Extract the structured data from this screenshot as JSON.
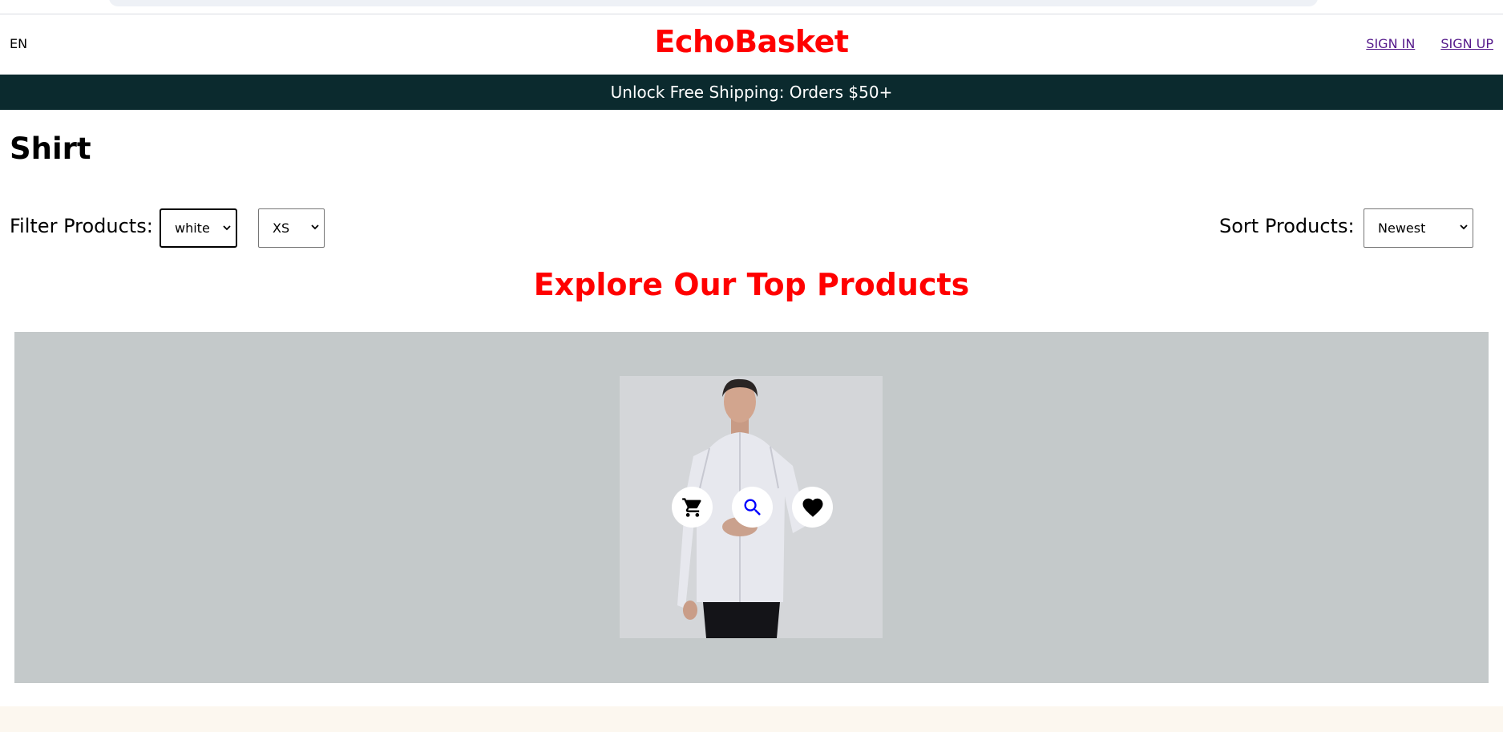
{
  "header": {
    "language": "EN",
    "logo": "EchoBasket",
    "sign_in": "SIGN IN",
    "sign_up": "SIGN UP"
  },
  "announcement": "Unlock Free Shipping: Orders $50+",
  "page_title": "Shirt",
  "filters": {
    "label": "Filter Products:",
    "color": {
      "selected": "white"
    },
    "size": {
      "selected": "XS"
    }
  },
  "sort": {
    "label": "Sort Products:",
    "selected": "Newest"
  },
  "section_title": "Explore Our Top Products",
  "product_actions": {
    "cart_icon": "cart-icon",
    "search_icon": "search-icon",
    "heart_icon": "heart-icon"
  },
  "colors": {
    "brand_red": "#ff0000",
    "announcement_bg": "#0b2a2e",
    "products_bg": "#c4c9ca",
    "link_purple": "#551a8b",
    "search_icon_blue": "#0000ff",
    "footer_bg": "#fcf7ef"
  }
}
